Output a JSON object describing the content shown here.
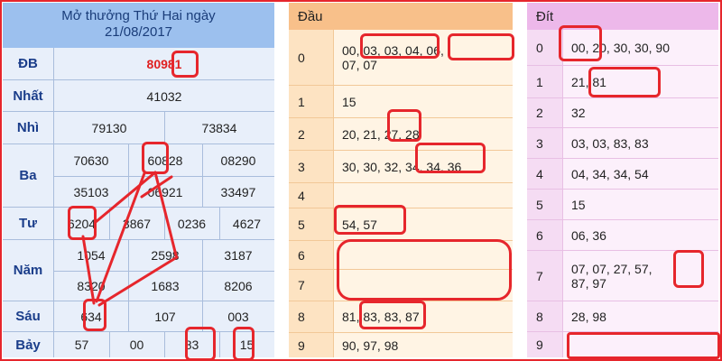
{
  "results": {
    "header_line1": "Mở thưởng Thứ Hai ngày",
    "header_line2": "21/08/2017",
    "rows": {
      "db": {
        "label": "ĐB",
        "values": [
          "80981"
        ]
      },
      "nhat": {
        "label": "Nhất",
        "values": [
          "41032"
        ]
      },
      "nhi": {
        "label": "Nhì",
        "values": [
          "79130",
          "73834"
        ]
      },
      "ba": {
        "label": "Ba",
        "values": [
          "70630",
          "60828",
          "08290",
          "35103",
          "06921",
          "33497"
        ]
      },
      "tu": {
        "label": "Tư",
        "values": [
          "6204",
          "3867",
          "0236",
          "4627"
        ]
      },
      "nam": {
        "label": "Năm",
        "values": [
          "1054",
          "2598",
          "3187",
          "8320",
          "1683",
          "8206"
        ]
      },
      "sau": {
        "label": "Sáu",
        "values": [
          "634",
          "107",
          "003"
        ]
      },
      "bay": {
        "label": "Bảy",
        "values": [
          "57",
          "00",
          "83",
          "15"
        ]
      }
    }
  },
  "dau": {
    "title": "Đầu",
    "rows": [
      {
        "k": "0",
        "v": "00, 03, 03, 04, 06, 07, 07"
      },
      {
        "k": "1",
        "v": "15"
      },
      {
        "k": "2",
        "v": "20, 21, 27, 28"
      },
      {
        "k": "3",
        "v": "30, 30, 32, 34, 34, 36"
      },
      {
        "k": "4",
        "v": ""
      },
      {
        "k": "5",
        "v": "54, 57"
      },
      {
        "k": "6",
        "v": ""
      },
      {
        "k": "7",
        "v": ""
      },
      {
        "k": "8",
        "v": "81, 83, 83, 87"
      },
      {
        "k": "9",
        "v": "90, 97, 98"
      }
    ]
  },
  "dit": {
    "title": "Đít",
    "rows": [
      {
        "k": "0",
        "v": "00, 20, 30, 30, 90"
      },
      {
        "k": "1",
        "v": "21, 81"
      },
      {
        "k": "2",
        "v": "32"
      },
      {
        "k": "3",
        "v": "03, 03, 83, 83"
      },
      {
        "k": "4",
        "v": "04, 34, 34, 54"
      },
      {
        "k": "5",
        "v": "15"
      },
      {
        "k": "6",
        "v": "06, 36"
      },
      {
        "k": "7",
        "v": "07, 07, 27, 57, 87, 97"
      },
      {
        "k": "8",
        "v": "28, 98"
      },
      {
        "k": "9",
        "v": ""
      }
    ]
  },
  "colors": {
    "annotation": "#e6262c",
    "special_prize": "#e02020",
    "label": "#1a3d8a"
  }
}
